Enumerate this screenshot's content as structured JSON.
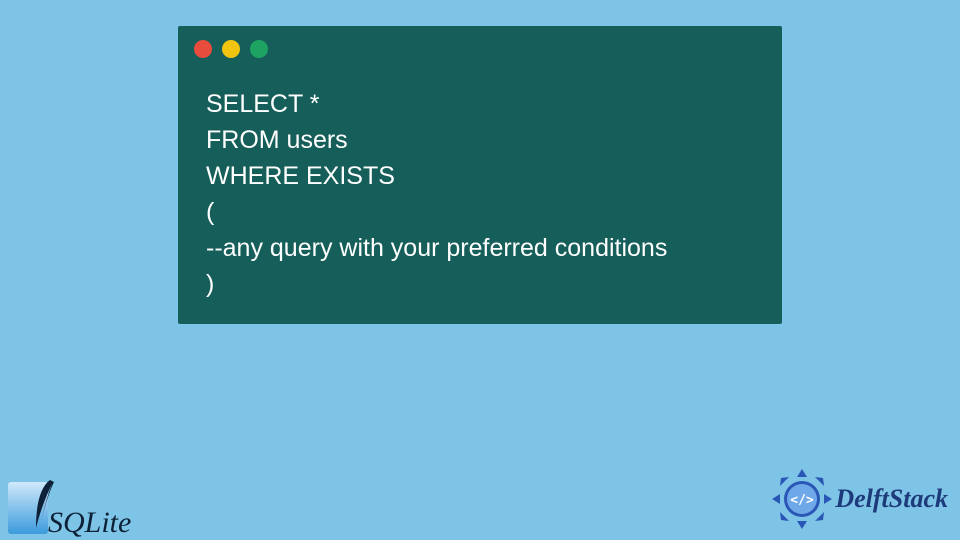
{
  "code": {
    "lines": [
      "SELECT *",
      "FROM users",
      "WHERE EXISTS",
      "(",
      "--any query with your preferred conditions",
      ")"
    ]
  },
  "logos": {
    "left": "SQLite",
    "right": "DelftStack"
  },
  "window": {
    "dots": [
      "red",
      "yellow",
      "green"
    ]
  }
}
